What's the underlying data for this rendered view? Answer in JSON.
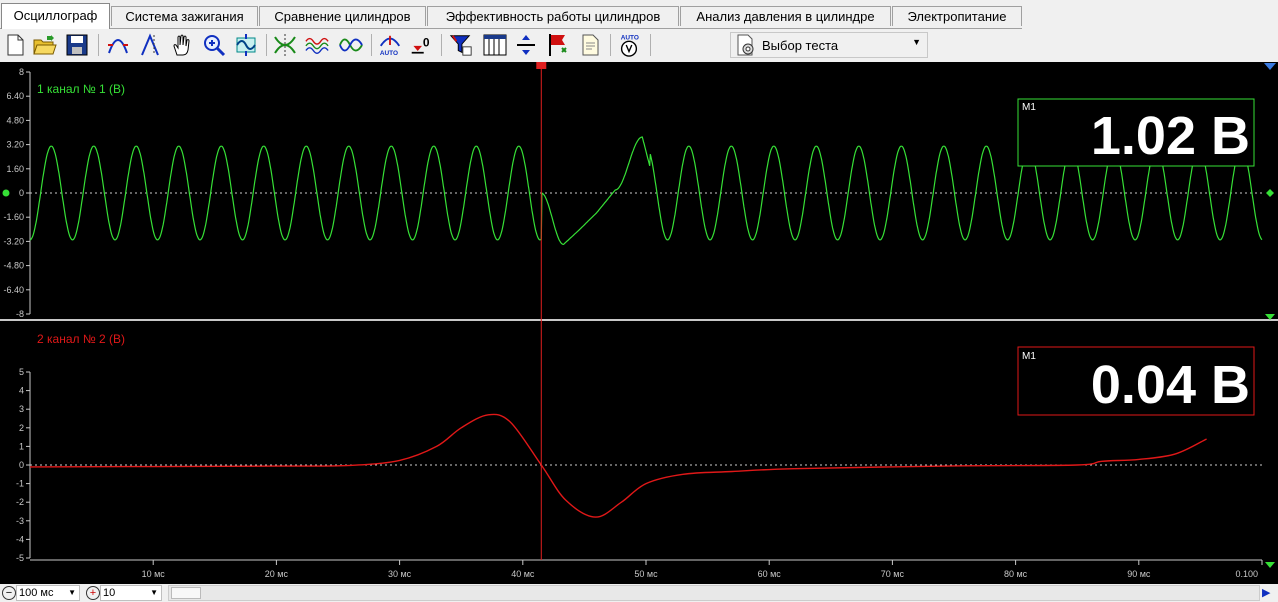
{
  "tabs": [
    {
      "label": "Осциллограф",
      "active": true
    },
    {
      "label": "Система зажигания",
      "active": false
    },
    {
      "label": "Сравнение цилиндров",
      "active": false
    },
    {
      "label": "Эффективность работы цилиндров",
      "active": false
    },
    {
      "label": "Анализ давления в цилиндре",
      "active": false
    },
    {
      "label": "Электропитание",
      "active": false
    }
  ],
  "toolbar": {
    "auto_label_1": "AUTO",
    "trigger_level": "0",
    "auto_label_2": "AUTO",
    "test_select": "Выбор теста"
  },
  "colors": {
    "channel1": "#36e036",
    "channel2": "#e01818",
    "cursor": "#e02020",
    "background": "#000000",
    "grid_zero": "#cccccc"
  },
  "channel1": {
    "title": "1  канал № 1 (В)",
    "measure_label": "M1",
    "measure_value": "1.02 В",
    "y_ticks": [
      "8",
      "6.40",
      "4.80",
      "3.20",
      "1.60",
      "0",
      "-1.60",
      "-3.20",
      "-4.80",
      "-6.40",
      "-8"
    ],
    "ylim": [
      -8,
      8
    ]
  },
  "channel2": {
    "title": "2  канал № 2 (В)",
    "measure_label": "M1",
    "measure_value": "0.04 В",
    "y_ticks": [
      "5",
      "4",
      "3",
      "2",
      "1",
      "0",
      "-1",
      "-2",
      "-3",
      "-4",
      "-5"
    ],
    "ylim": [
      -5,
      5
    ]
  },
  "x_axis": {
    "ticks": [
      "10 мс",
      "20 мс",
      "30 мс",
      "40 мс",
      "50 мс",
      "60 мс",
      "70 мс",
      "80 мс",
      "90 мс",
      "0.100"
    ],
    "xlim": [
      0,
      100
    ],
    "cursor_ms": 41.5
  },
  "chart_data": [
    {
      "type": "line",
      "title": "1  канал № 1 (В)",
      "xlabel": "",
      "ylabel": "",
      "xlim": [
        0,
        100
      ],
      "ylim": [
        -8,
        8
      ],
      "series": [
        {
          "name": "канал № 1 (В)",
          "description": "sinusoid ~3.1 V amplitude, ~3.5 ms period, disturbed near 41.5–50 ms",
          "x": [
            0,
            0.9,
            1.8,
            2.6,
            3.5,
            41.5,
            43.3,
            44.5,
            46,
            47.5,
            49.7,
            50.3,
            51.6,
            53.3,
            70,
            90,
            100
          ],
          "y": [
            -3.1,
            0,
            3.1,
            0,
            -3.1,
            0,
            -3.4,
            -2.5,
            -1.3,
            0.2,
            3.7,
            1.8,
            -3.0,
            3.1,
            0,
            -3.1,
            -3.1
          ]
        }
      ]
    },
    {
      "type": "line",
      "title": "2  канал № 2 (В)",
      "xlabel": "",
      "ylabel": "",
      "xlim": [
        0,
        100
      ],
      "ylim": [
        -5,
        5
      ],
      "series": [
        {
          "name": "канал № 2 (В)",
          "x": [
            0,
            20,
            26,
            30,
            33,
            35,
            37.2,
            39,
            41.5,
            43.5,
            45.9,
            48,
            50,
            53,
            57,
            62,
            75,
            85,
            87,
            90,
            93,
            95.5
          ],
          "y": [
            -0.1,
            -0.06,
            -0.02,
            0.25,
            1.0,
            2.0,
            2.7,
            2.3,
            0.0,
            -1.9,
            -2.8,
            -2.0,
            -1.0,
            -0.5,
            -0.35,
            -0.2,
            -0.05,
            0.0,
            0.2,
            0.3,
            0.6,
            1.4
          ]
        }
      ]
    }
  ],
  "status": {
    "timebase": "100 мс",
    "zoom_value": "10"
  }
}
